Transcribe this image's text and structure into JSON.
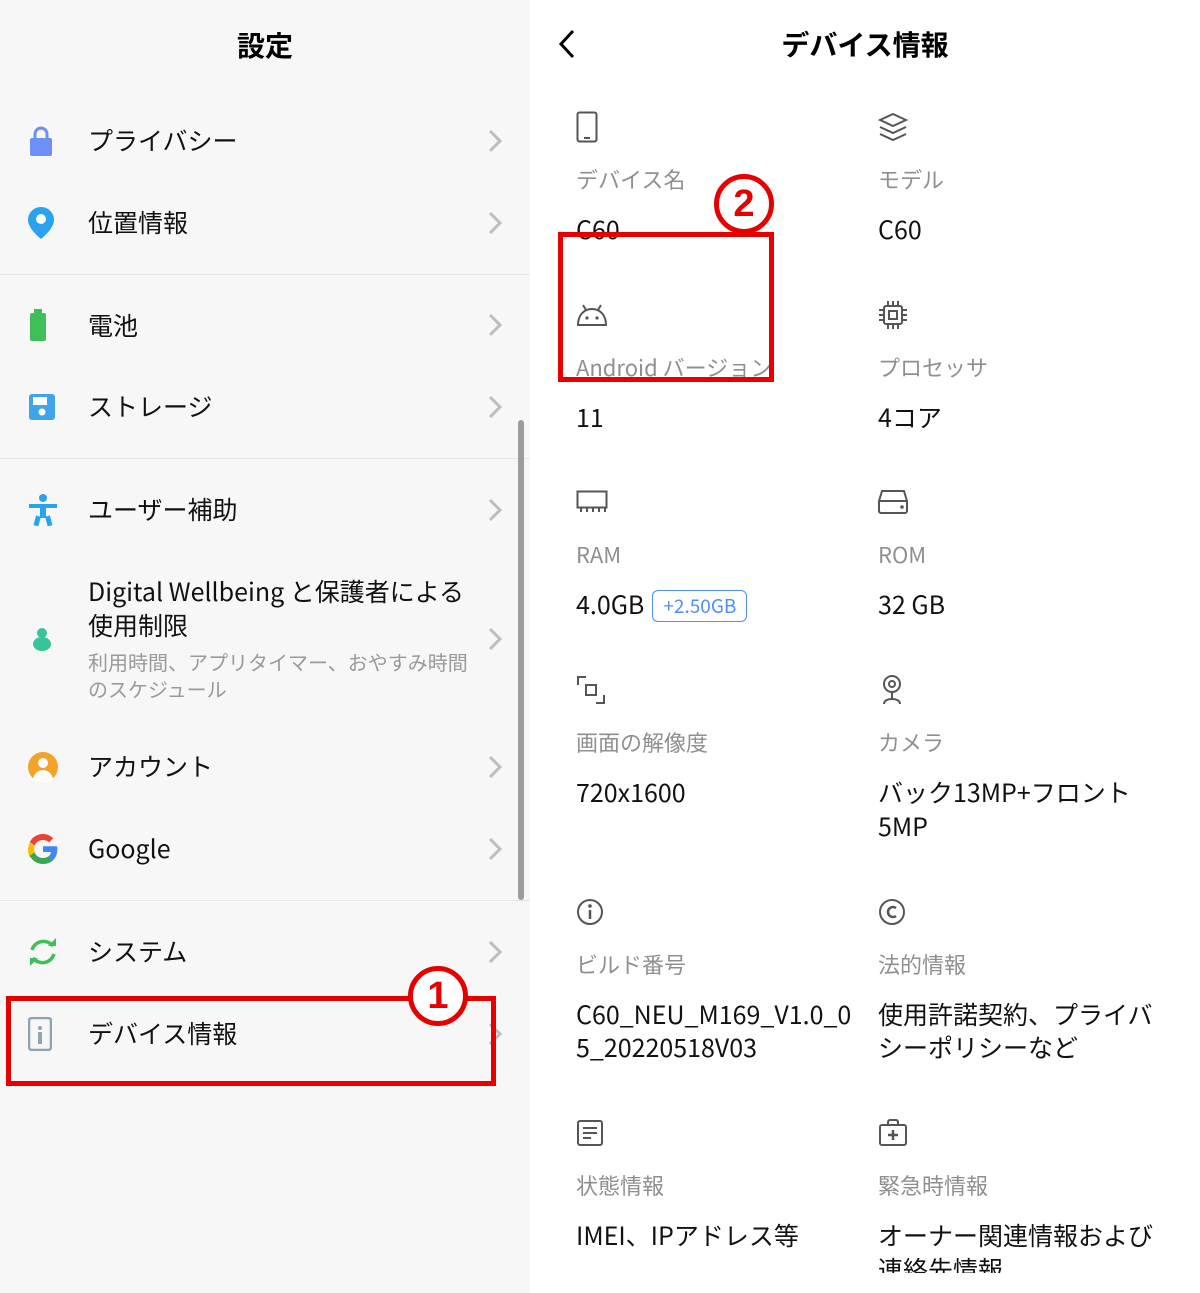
{
  "left": {
    "title": "設定",
    "items": {
      "privacy": "プライバシー",
      "location": "位置情報",
      "battery": "電池",
      "storage": "ストレージ",
      "accessibility": "ユーザー補助",
      "wellbeing_label": "Digital Wellbeing と保護者による使用制限",
      "wellbeing_sub": "利用時間、アプリタイマー、おやすみ時間のスケジュール",
      "account": "アカウント",
      "google": "Google",
      "system": "システム",
      "device_info": "デバイス情報"
    }
  },
  "right": {
    "title": "デバイス情報",
    "cells": {
      "device_name": {
        "label": "デバイス名",
        "value": "C60"
      },
      "model": {
        "label": "モデル",
        "value": "C60"
      },
      "android_version": {
        "label": "Android バージョン",
        "value": "11"
      },
      "processor": {
        "label": "プロセッサ",
        "value": "4コア"
      },
      "ram": {
        "label": "RAM",
        "value": "4.0GB",
        "badge": "+2.50GB"
      },
      "rom": {
        "label": "ROM",
        "value": "32 GB"
      },
      "resolution": {
        "label": "画面の解像度",
        "value": "720x1600"
      },
      "camera": {
        "label": "カメラ",
        "value": "バック13MP+フロント5MP"
      },
      "build": {
        "label": "ビルド番号",
        "value": "C60_NEU_M169_V1.0_05_20220518V03"
      },
      "legal": {
        "label": "法的情報",
        "value": "使用許諾契約、プライバシーポリシーなど"
      },
      "status": {
        "label": "状態情報",
        "value": "IMEI、IPアドレス等"
      },
      "emergency": {
        "label": "緊急時情報",
        "value": "オーナー関連情報および連絡先情報"
      }
    }
  },
  "annotations": {
    "1": "1",
    "2": "2"
  }
}
